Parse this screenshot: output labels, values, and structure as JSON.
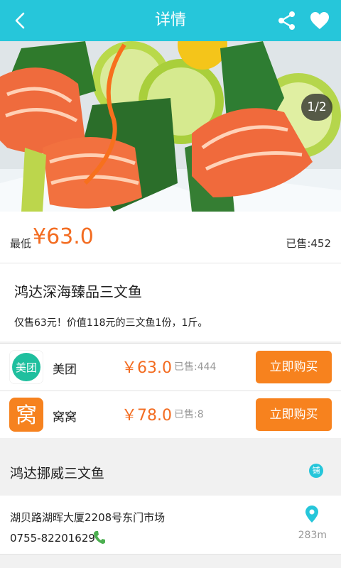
{
  "header": {
    "title": "详情",
    "color": "#26c6da"
  },
  "gallery": {
    "counter": "1/2"
  },
  "price": {
    "lowest_label": "最低",
    "lowest_value": "¥63.0",
    "sold_total": "已售:452",
    "accent": "#f36c21"
  },
  "deal": {
    "title": "鸿达深海臻品三文鱼",
    "description": "仅售63元！价值118元的三文鱼1份，1斤。"
  },
  "sellers": [
    {
      "logo_text": "美团",
      "name": "美团",
      "price": "￥63.0",
      "sold": "已售:444",
      "buy_label": "立即购买",
      "logo_color": "#1fbf9e"
    },
    {
      "logo_text": "窝",
      "name": "窝窝",
      "price": "￥78.0",
      "sold": "已售:8",
      "buy_label": "立即购买",
      "logo_color": "#f6821f"
    }
  ],
  "shop": {
    "name": "鸿达挪威三文鱼",
    "badge": "铺",
    "address": "湖贝路湖晖大厦2208号东门市场",
    "phone": "0755-82201629",
    "distance": "283m"
  },
  "icons": {
    "back": "chevron-left-icon",
    "share": "share-icon",
    "favorite": "heart-icon",
    "location": "map-pin-icon",
    "phone": "phone-icon"
  }
}
